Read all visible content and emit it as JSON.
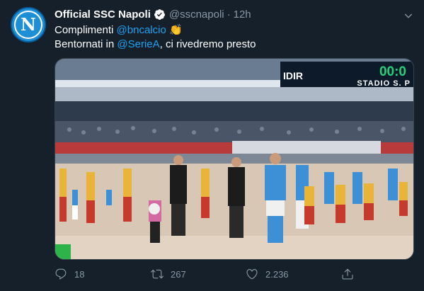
{
  "tweet": {
    "author_name": "Official SSC Napoli",
    "handle": "@sscnapoli",
    "separator": "·",
    "time": "12h",
    "line1_prefix": "Complimenti ",
    "line1_mention": "@bncalcio",
    "line1_emoji": "👏",
    "line2_prefix": "Bentornati in ",
    "line2_mention": "@SerieA",
    "line2_suffix": ", ci rivedremo presto"
  },
  "avatar": {
    "letter": "N"
  },
  "media": {
    "scoreboard_score": "00:0",
    "scoreboard_stadium": "STADIO S. P",
    "sponsor_left": "IDIR"
  },
  "actions": {
    "replies": "18",
    "retweets": "267",
    "likes": "2.236"
  },
  "colors": {
    "background": "#15202b",
    "link": "#1da1f2",
    "muted": "#8899a6",
    "napoli_blue": "#1d8fd6"
  }
}
